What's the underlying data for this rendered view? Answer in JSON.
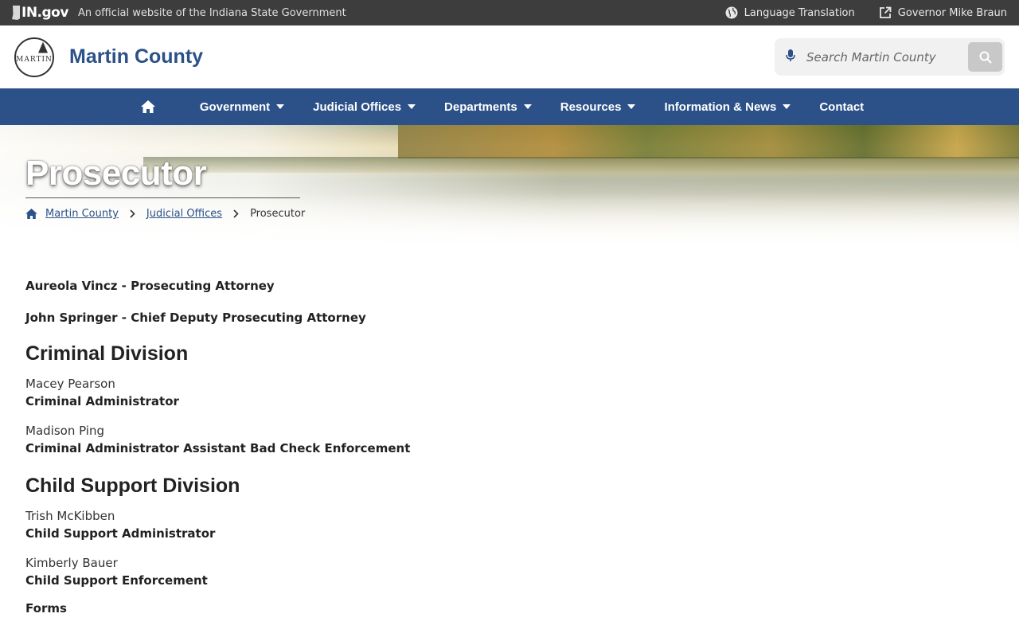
{
  "topbar": {
    "ingov_logo": "IN.gov",
    "official_text": "An official website of the Indiana State Government",
    "language_label": "Language Translation",
    "governor_label": "Governor Mike Braun"
  },
  "header": {
    "seal_text": "MARTIN",
    "site_title": "Martin County",
    "search_placeholder": "Search Martin County"
  },
  "nav": {
    "items": [
      {
        "label": "Government",
        "has_dropdown": true
      },
      {
        "label": "Judicial Offices",
        "has_dropdown": true
      },
      {
        "label": "Departments",
        "has_dropdown": true
      },
      {
        "label": "Resources",
        "has_dropdown": true
      },
      {
        "label": "Information & News",
        "has_dropdown": true
      },
      {
        "label": "Contact",
        "has_dropdown": false
      }
    ]
  },
  "hero": {
    "title": "Prosecutor",
    "breadcrumbs": [
      "Martin County",
      "Judicial Offices",
      "Prosecutor"
    ]
  },
  "content": {
    "leaders": [
      "Aureola Vincz - Prosecuting Attorney",
      "John Springer - Chief Deputy Prosecuting Attorney"
    ],
    "criminal": {
      "heading": "Criminal Division",
      "people": [
        {
          "name": "Macey Pearson",
          "title": "Criminal Administrator"
        },
        {
          "name": "Madison Ping",
          "title": "Criminal Administrator Assistant Bad Check Enforcement"
        }
      ]
    },
    "child_support": {
      "heading": "Child Support Division",
      "people": [
        {
          "name": "Trish McKibben",
          "title": "Child Support Administrator"
        },
        {
          "name": "Kimberly Bauer",
          "title": "Child Support Enforcement"
        }
      ]
    },
    "forms_label": "Forms"
  },
  "colors": {
    "brand_blue": "#2b5188",
    "topbar_bg": "#3d3d3d"
  }
}
